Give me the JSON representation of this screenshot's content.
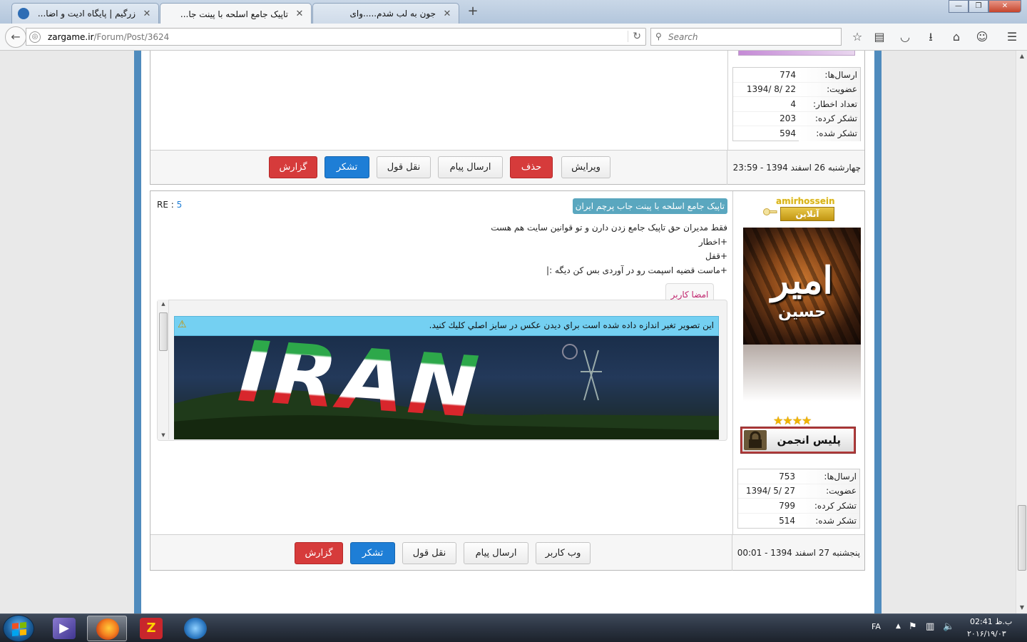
{
  "browser": {
    "tabs": [
      {
        "title": "زرگیم | پایگاه ادیت و اضا...",
        "active": false
      },
      {
        "title": "تاپیک جامع اسلحه با پینت جا...",
        "active": true
      },
      {
        "title": "جون به لب شدم.....وای",
        "active": false
      }
    ],
    "new_tab": "+",
    "url_host": "zargame.ir",
    "url_path": "/Forum/Post/3624",
    "search_placeholder": "Search",
    "window_buttons": {
      "minimize": "—",
      "maximize": "❐",
      "close": "✕"
    }
  },
  "post1": {
    "stats": [
      {
        "label": "ارسال‌ها:",
        "value": "774"
      },
      {
        "label": "عضویت:",
        "value": "1394/ 8/ 22"
      },
      {
        "label": "تعداد اخطار:",
        "value": "4"
      },
      {
        "label": "تشکر کرده:",
        "value": "203"
      },
      {
        "label": "تشکر شده:",
        "value": "594"
      }
    ],
    "date": "چهارشنبه 26 اسفند 1394 - 23:59",
    "buttons": {
      "edit": "ویرایش",
      "delete": "حذف",
      "send_message": "ارسال پیام",
      "quote": "نقل قول",
      "thanks": "تشکر",
      "report": "گزارش"
    }
  },
  "post2": {
    "username": "amirhossein",
    "online_badge": "آنلاین",
    "avatar_text_main": "امیر",
    "avatar_text_sub": "حسین",
    "rank": "پلیس انجمن",
    "stars": 4,
    "stats": [
      {
        "label": "ارسال‌ها:",
        "value": "753"
      },
      {
        "label": "عضویت:",
        "value": "1394/ 5/ 27"
      },
      {
        "label": "تشکر کرده:",
        "value": "799"
      },
      {
        "label": "تشکر شده:",
        "value": "514"
      }
    ],
    "title": "تاپیک جامع اسلحه با پینت جاب پرچم ایران",
    "re_label": "RE : ",
    "re_number": "5",
    "body": [
      "فقط مدیران حق تاپیک جامع زدن دارن و تو قوانین سایت هم هست",
      "+اخطار",
      "+قفل",
      "+ماست قضیه اسپمت رو در آوردی بس کن دیگه :|"
    ],
    "signature_tab": "امضا کاربر",
    "resize_notice": "اين تصوير تغير اندازه داده شده است براي ديدن عكس در سايز اصلي كليك كنيد.",
    "signature_image_text": "IRAN",
    "date": "پنجشنبه 27 اسفند 1394 - 00:01",
    "buttons": {
      "website": "وب کاربر",
      "send_message": "ارسال پیام",
      "quote": "نقل قول",
      "thanks": "تشکر",
      "report": "گزارش"
    }
  },
  "taskbar": {
    "lang": "FA",
    "time": "02:41 ب.ظ",
    "date": "۲۰۱۶/۱۹/۰۳"
  },
  "colors": {
    "frame_blue": "#4f8bbd",
    "button_red": "#d63b3b",
    "button_blue": "#1e7ed6",
    "title_badge": "#5aa7bf",
    "warning_bar": "#74d0f2"
  }
}
